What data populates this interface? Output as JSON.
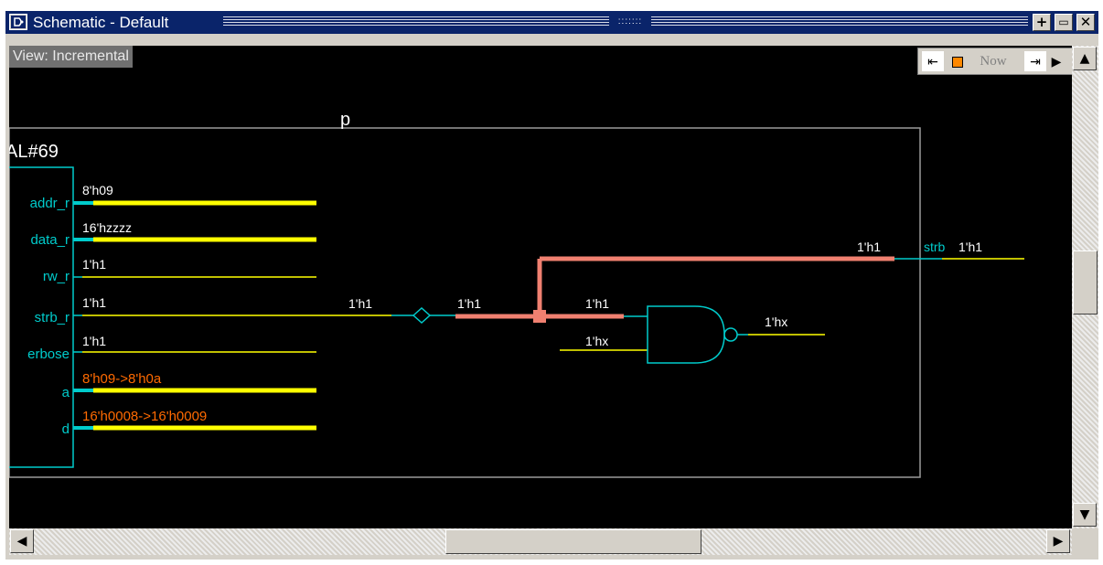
{
  "window": {
    "title": "Schematic - Default",
    "grip": ":::::::",
    "buttons": {
      "maximize": "+",
      "restore": "▭",
      "close": "✕"
    }
  },
  "view_label": "View: Incremental",
  "toolbar": {
    "now_label": "Now"
  },
  "schematic": {
    "module_label": "p",
    "instance_label": "AL#69",
    "ports": [
      "addr_r",
      "data_r",
      "rw_r",
      "strb_r",
      "erbose",
      "a",
      "d"
    ],
    "port_values": [
      "8'h09",
      "16'hzzzz",
      "1'h1",
      "1'h1",
      "1'h1",
      "8'h09->8'h0a",
      "16'h0008->16'h0009"
    ],
    "net_labels": {
      "strb_in": "1'h1",
      "buffer_out": "1'h1",
      "nand_in_a": "1'h1",
      "nand_in_b": "1'hx",
      "nand_out": "1'hx",
      "strb_out_value": "1'h1",
      "strb_port": "strb",
      "strb_port_value": "1'h1"
    }
  },
  "colors": {
    "canvas": "#000000",
    "wire": "#ffff00",
    "highlight": "#f08070",
    "cyan": "#00cccc",
    "changed": "#ff6a00"
  }
}
